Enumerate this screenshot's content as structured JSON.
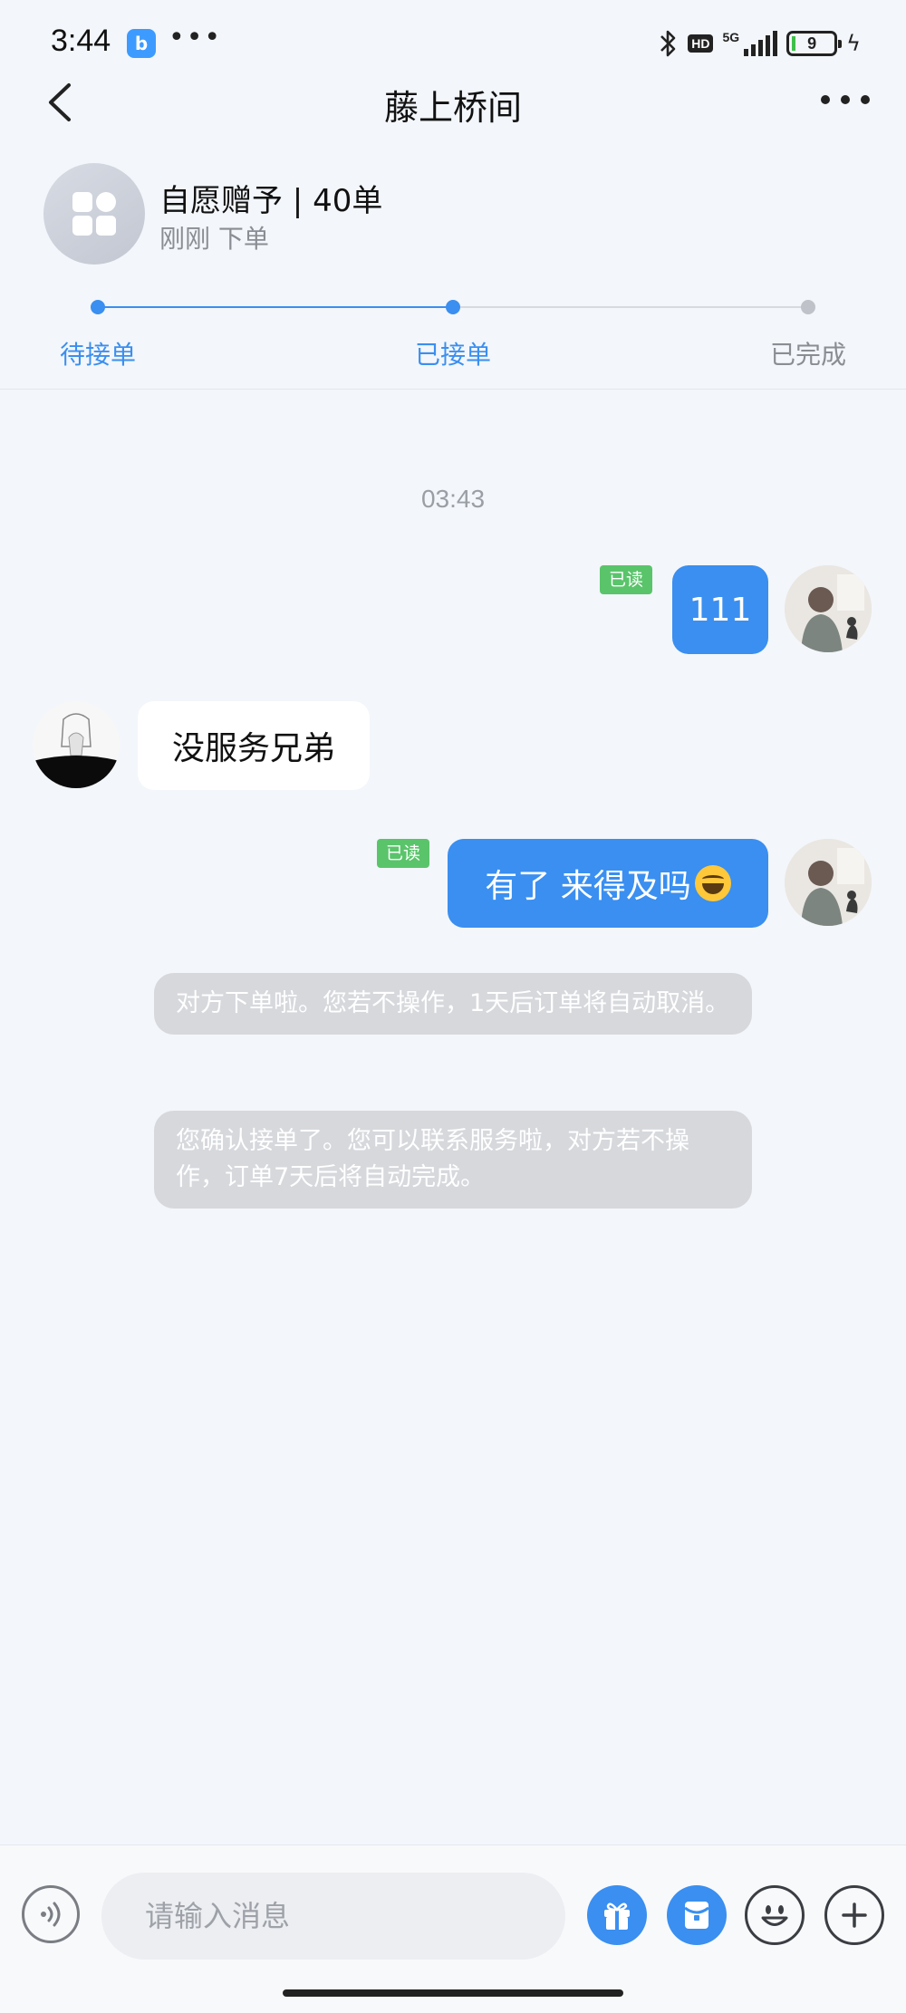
{
  "status_bar": {
    "time": "3:44",
    "app_icon_glyph": "b",
    "more": "•••",
    "hd": "HD",
    "network": "5G",
    "battery": "9"
  },
  "nav": {
    "title": "藤上桥间"
  },
  "order": {
    "title": "自愿赠予 | 40单",
    "subtitle": "刚刚  下单"
  },
  "progress": {
    "steps": [
      {
        "label": "待接单",
        "state": "done"
      },
      {
        "label": "已接单",
        "state": "current"
      },
      {
        "label": "已完成",
        "state": "pending"
      }
    ],
    "active_color": "#3a8ff0",
    "inactive_color": "#bfc3c9"
  },
  "chat": {
    "timestamp": "03:43",
    "messages": [
      {
        "from": "me",
        "text": "111",
        "read_label": "已读"
      },
      {
        "from": "other",
        "text": "没服务兄弟"
      },
      {
        "from": "me",
        "text": "有了 来得及吗",
        "emoji": "laughing-emoji",
        "read_label": "已读"
      }
    ],
    "system_messages": [
      "对方下单啦。您若不操作，1天后订单将自动取消。",
      "您确认接单了。您可以联系服务啦，对方若不操作，订单7天后将自动完成。"
    ],
    "bubble_color_me": "#3a8ff0",
    "read_badge_color": "#5ac46b"
  },
  "input": {
    "placeholder": "请输入消息"
  },
  "icons": {
    "voice": "voice-icon",
    "gift": "gift-icon",
    "red_packet": "red-packet-icon",
    "emoji": "emoji-icon",
    "add": "add-icon"
  }
}
